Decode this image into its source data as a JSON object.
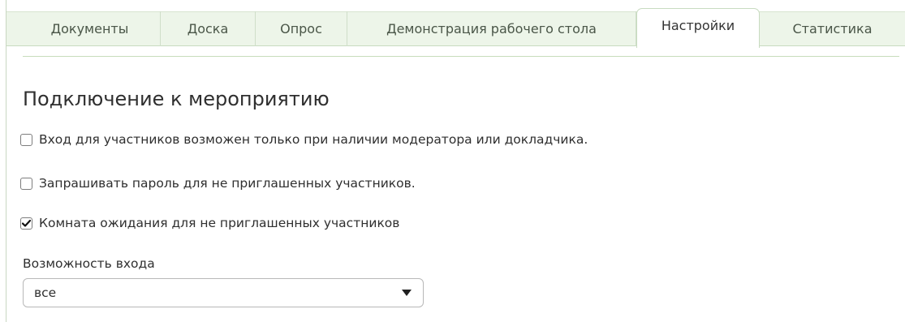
{
  "tabs": [
    {
      "label": "Документы",
      "active": false
    },
    {
      "label": "Доска",
      "active": false
    },
    {
      "label": "Опрос",
      "active": false
    },
    {
      "label": "Демонстрация рабочего стола",
      "active": false
    },
    {
      "label": "Настройки",
      "active": true
    },
    {
      "label": "Статистика",
      "active": false
    }
  ],
  "section": {
    "title": "Подключение к мероприятию"
  },
  "options": [
    {
      "label": "Вход для участников возможен только при наличии модератора или докладчика.",
      "checked": false
    },
    {
      "label": "Запрашивать пароль для не приглашенных участников.",
      "checked": false
    },
    {
      "label": "Комната ожидания для не приглашенных участников",
      "checked": true
    }
  ],
  "entry": {
    "label": "Возможность входа",
    "selected": "все"
  },
  "colors": {
    "tab_background": "#edf5e9",
    "accent_border": "#c7dcbc",
    "text": "#2f2f2f"
  },
  "icons": {
    "checkmark": "checkmark-icon",
    "dropdown": "triangle-down-icon"
  }
}
